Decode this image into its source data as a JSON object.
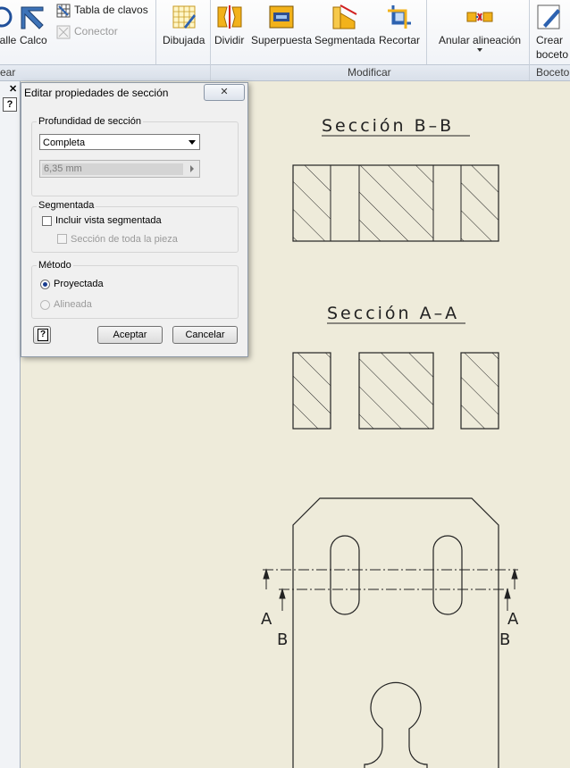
{
  "ribbon": {
    "partial_left_1": "alle",
    "partial_left_2": "Calco",
    "tabla_de_clavos": "Tabla de clavos",
    "conector": "Conector",
    "dibujada": "Dibujada",
    "dividir": "Dividir",
    "superpuesta": "Superpuesta",
    "segmentada": "Segmentada",
    "recortar": "Recortar",
    "anular_alineacion": "Anular alineación",
    "crear_boceto_1": "Crear",
    "crear_boceto_2": "boceto",
    "group_left": "ear",
    "group_modificar": "Modificar",
    "group_boceto": "Boceto"
  },
  "dialog": {
    "title": "Editar propiedades de sección",
    "depth_legend": "Profundidad de sección",
    "depth_selected": "Completa",
    "depth_value": "6,35 mm",
    "seg_legend": "Segmentada",
    "include_segmented": "Incluir vista segmentada",
    "section_whole_part": "Sección de toda la pieza",
    "method_legend": "Método",
    "projected": "Proyectada",
    "aligned": "Alineada",
    "accept": "Aceptar",
    "cancel": "Cancelar"
  },
  "drawing": {
    "section_bb": "Sección B–B",
    "section_aa": "Sección A–A",
    "label_a": "A",
    "label_b": "B"
  }
}
